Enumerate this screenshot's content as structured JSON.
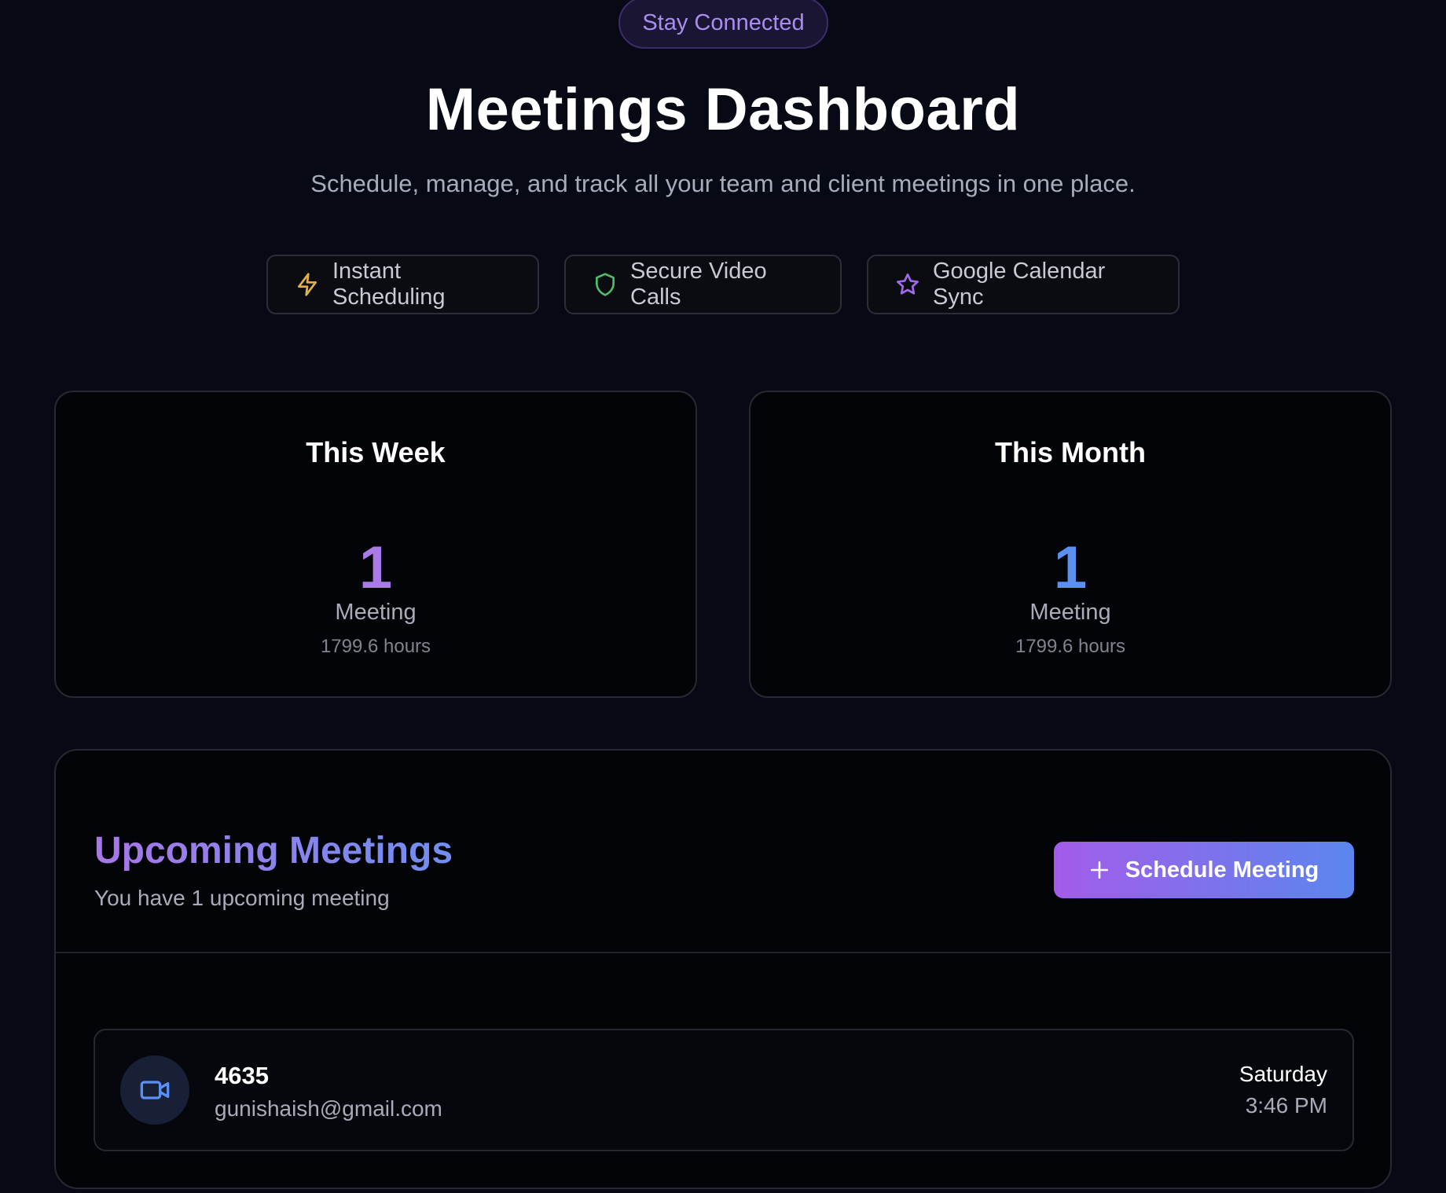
{
  "hero": {
    "pill": "Stay Connected",
    "title": "Meetings Dashboard",
    "subtitle": "Schedule, manage, and track all your team and client meetings in one place.",
    "features": [
      {
        "label": "Instant Scheduling",
        "icon": "lightning-icon",
        "color": "#e2b04a"
      },
      {
        "label": "Secure Video Calls",
        "icon": "shield-icon",
        "color": "#4cbf6b"
      },
      {
        "label": "Google Calendar Sync",
        "icon": "star-icon",
        "color": "#a06ae8"
      }
    ]
  },
  "stats": [
    {
      "title": "This Week",
      "value": "1",
      "label": "Meeting",
      "sub": "1799.6 hours",
      "color": "#a97ae8"
    },
    {
      "title": "This Month",
      "value": "1",
      "label": "Meeting",
      "sub": "1799.6 hours",
      "color": "#5b8ff0"
    }
  ],
  "upcoming": {
    "title": "Upcoming Meetings",
    "subtitle": "You have 1 upcoming meeting",
    "button_label": "Schedule Meeting",
    "button_icon": "plus-icon",
    "meetings": [
      {
        "name": "4635",
        "email": "gunishaish@gmail.com",
        "day": "Saturday",
        "time": "3:46 PM",
        "icon": "video-camera-icon"
      }
    ]
  }
}
